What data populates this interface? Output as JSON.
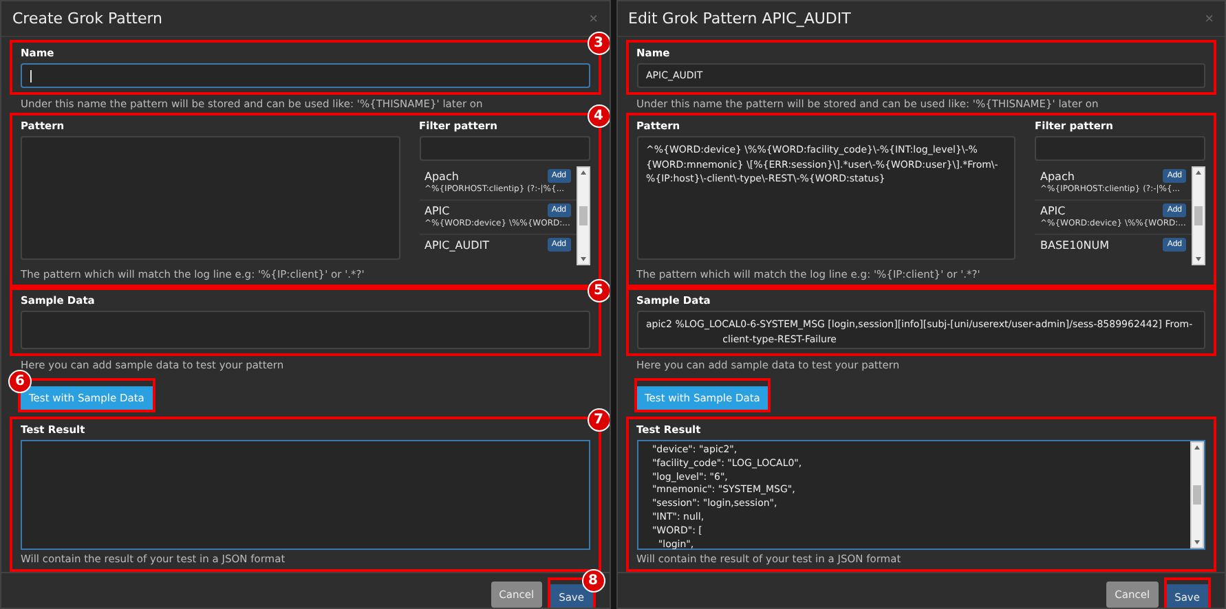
{
  "dialogs": [
    {
      "title": "Create Grok Pattern",
      "close": "×",
      "name": {
        "label": "Name",
        "focused": true,
        "hint": "Under this name the pattern will be stored and can be used like: '%{THISNAME}' later on",
        "highlighted": true,
        "callout": "3"
      },
      "pattern": {
        "label": "Pattern",
        "hint": "The pattern which will match the log line e.g: '%{IP:client}' or '.*?'",
        "highlighted": true,
        "callout": "4"
      },
      "filter": {
        "label": "Filter pattern",
        "items": [
          {
            "name": "Apach",
            "pattern": "^%{IPORHOST:clientip} (?:-|%{...",
            "add": "Add"
          },
          {
            "name": "APIC",
            "pattern": "^%{WORD:device} \\%%{WORD:...",
            "add": "Add"
          },
          {
            "name": "APIC_AUDIT",
            "add": "Add"
          }
        ]
      },
      "sample": {
        "label": "Sample Data",
        "hint": "Here you can add sample data to test your pattern",
        "highlighted": true,
        "callout": "5"
      },
      "test_button": {
        "label": "Test with Sample Data",
        "highlighted": true,
        "callout": "6"
      },
      "result": {
        "label": "Test Result",
        "hint": "Will contain the result of your test in a JSON format",
        "highlighted": true,
        "callout": "7"
      },
      "buttons": {
        "cancel": "Cancel",
        "save": "Save",
        "save_highlighted": true,
        "callout": "8"
      }
    },
    {
      "title": "Edit Grok Pattern APIC_AUDIT",
      "close": "×",
      "name": {
        "label": "Name",
        "value": "APIC_AUDIT",
        "focused": false,
        "hint": "Under this name the pattern will be stored and can be used like: '%{THISNAME}' later on",
        "highlighted": true
      },
      "pattern": {
        "label": "Pattern",
        "value": "^%{WORD:device} \\%%{WORD:facility_code}\\-%{INT:log_level}\\-%{WORD:mnemonic} \\[%{ERR:session}\\].*user\\-%{WORD:user}\\].*From\\-%{IP:host}\\-client\\-type\\-REST\\-%{WORD:status}",
        "hint": "The pattern which will match the log line e.g: '%{IP:client}' or '.*?'",
        "highlighted": true
      },
      "filter": {
        "label": "Filter pattern",
        "items": [
          {
            "name": "Apach",
            "pattern": "^%{IPORHOST:clientip} (?:-|%{...",
            "add": "Add"
          },
          {
            "name": "APIC",
            "pattern": "^%{WORD:device} \\%%{WORD:...",
            "add": "Add"
          },
          {
            "name": "BASE10NUM",
            "add": "Add"
          }
        ]
      },
      "sample": {
        "label": "Sample Data",
        "value": "apic2 %LOG_LOCAL0-6-SYSTEM_MSG [login,session][info][subj-[uni/userext/user-admin]/sess-8589962442] From-\n                         client-type-REST-Failure",
        "hint": "Here you can add sample data to test your pattern",
        "highlighted": true
      },
      "test_button": {
        "label": "Test with Sample Data",
        "highlighted": true
      },
      "result": {
        "label": "Test Result",
        "hint": "Will contain the result of your test in a JSON format",
        "highlighted": true,
        "lines": [
          "  \"device\": \"apic2\",",
          "  \"facility_code\": \"LOG_LOCAL0\",",
          "  \"log_level\": \"6\",",
          "  \"mnemonic\": \"SYSTEM_MSG\",",
          "  \"session\": \"login,session\",",
          "  \"INT\": null,",
          "  \"WORD\": [",
          "    \"login\","
        ]
      },
      "buttons": {
        "cancel": "Cancel",
        "save": "Save",
        "save_highlighted": true
      }
    }
  ]
}
